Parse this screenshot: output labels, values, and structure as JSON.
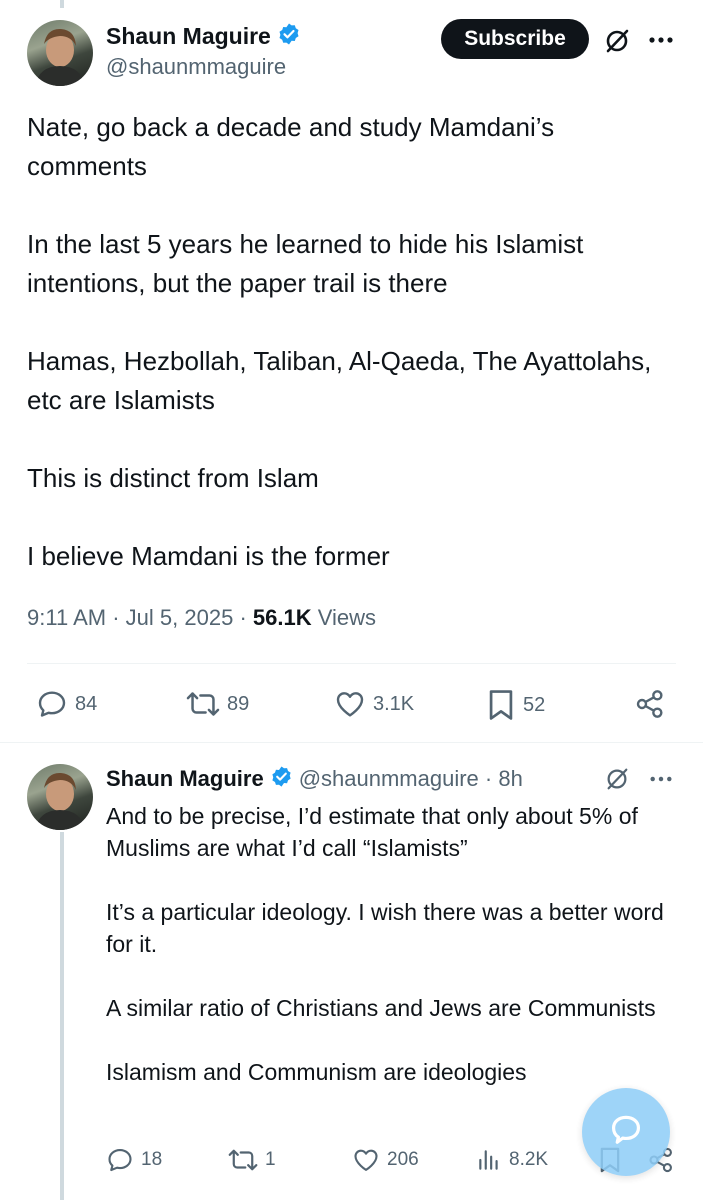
{
  "tweet": {
    "author_name": "Shaun Maguire",
    "author_handle": "@shaunmmaguire",
    "subscribe_label": "Subscribe",
    "paragraphs": [
      "Nate, go back a decade and study Mamdani’s comments",
      "In the last 5 years he learned to hide his Islamist intentions, but the paper trail is there",
      "Hamas, Hezbollah, Taliban, Al-Qaeda, The Ayattolahs, etc are Islamists",
      "This is distinct from Islam",
      "I believe Mamdani is the former"
    ],
    "time": "9:11 AM",
    "date": "Jul 5, 2025",
    "views_count": "56.1K",
    "views_label": "Views",
    "replies": "84",
    "reposts": "89",
    "likes": "3.1K",
    "bookmarks": "52"
  },
  "reply": {
    "author_name": "Shaun Maguire",
    "author_handle": "@shaunmmaguire",
    "age": "8h",
    "paragraphs": [
      "And to be precise, I’d estimate that only about 5% of Muslims are what I’d call “Islamists”",
      "It’s a particular ideology. I wish there was a better word for it.",
      "A similar ratio of Christians and Jews are Communists",
      "Islamism and Communism are ideologies"
    ],
    "replies": "18",
    "reposts": "1",
    "likes": "206",
    "views": "8.2K"
  },
  "icons": {
    "verified": "verified-badge-icon",
    "grok": "grok-icon",
    "more": "more-icon",
    "reply": "reply-icon",
    "repost": "repost-icon",
    "like": "heart-icon",
    "bookmark": "bookmark-icon",
    "share": "share-icon",
    "views": "views-icon",
    "compose": "compose-icon"
  },
  "colors": {
    "text": "#0f1419",
    "secondary": "#536471",
    "verified": "#1d9bf0",
    "fab": "#8ecdf7",
    "divider": "#eff3f4"
  }
}
